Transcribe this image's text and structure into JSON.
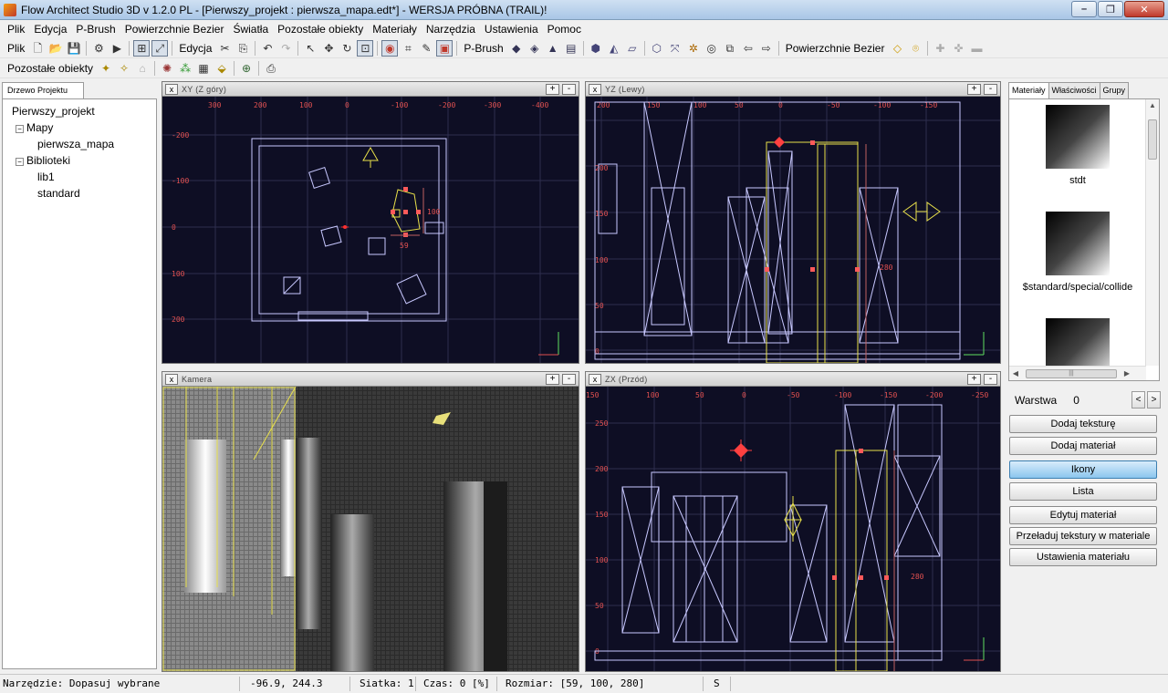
{
  "window": {
    "title": "Flow Architect Studio 3D v 1.2.0 PL  - [Pierwszy_projekt : pierwsza_mapa.edt*]  - WERSJA PRÓBNA (TRAIL)!"
  },
  "menu": [
    "Plik",
    "Edycja",
    "P-Brush",
    "Powierzchnie Bezier",
    "Światła",
    "Pozostałe obiekty",
    "Materiały",
    "Narzędzia",
    "Ustawienia",
    "Pomoc"
  ],
  "toolbar": {
    "plik": "Plik",
    "edycja": "Edycja",
    "pbrush": "P-Brush",
    "bezier": "Powierzchnie Bezier",
    "pozostale": "Pozostałe obiekty"
  },
  "left_panel": {
    "tab": "Drzewo Projektu",
    "tree": {
      "root": "Pierwszy_projekt",
      "mapy": "Mapy",
      "mapa": "pierwsza_mapa",
      "biblioteki": "Biblioteki",
      "lib1": "lib1",
      "standard": "standard"
    }
  },
  "viewports": {
    "xy": {
      "title": "XY (Z góry)",
      "close": "x",
      "plus": "+",
      "minus": "-",
      "xticks": [
        "300",
        "200",
        "100",
        "0",
        "-100",
        "-200",
        "-300",
        "-400"
      ],
      "yticks": [
        "-200",
        "-100",
        "0",
        "100",
        "200"
      ],
      "dim1": "100",
      "dim2": "59"
    },
    "yz": {
      "title": "YZ (Lewy)",
      "close": "x",
      "plus": "+",
      "minus": "-",
      "xticks": [
        "200",
        "150",
        "100",
        "50",
        "0",
        "-50",
        "-100",
        "-150"
      ],
      "yticks": [
        "200",
        "150",
        "100",
        "50",
        "0"
      ],
      "dim": "280"
    },
    "cam": {
      "title": "Kamera",
      "close": "x",
      "plus": "+",
      "minus": "-"
    },
    "zx": {
      "title": "ZX (Przód)",
      "close": "x",
      "plus": "+",
      "minus": "-",
      "xticks": [
        "150",
        "100",
        "50",
        "0",
        "-50",
        "-100",
        "-150",
        "-200",
        "-250"
      ],
      "yticks": [
        "250",
        "200",
        "150",
        "100",
        "50",
        "0"
      ],
      "dim": "280"
    }
  },
  "right_panel": {
    "tabs": [
      "Materiały",
      "Właściwości",
      "Grupy"
    ],
    "materials": [
      "stdt",
      "$standard/special/collide"
    ],
    "layer_label": "Warstwa",
    "layer_value": "0",
    "layer_prev": "<",
    "layer_next": ">",
    "buttons": {
      "add_texture": "Dodaj teksturę",
      "add_material": "Dodaj materiał",
      "icons": "Ikony",
      "list": "Lista",
      "edit_material": "Edytuj materiał",
      "reload": "Przeładuj tekstury w materiale",
      "settings": "Ustawienia materiału"
    }
  },
  "status": {
    "tool": "Narzędzie:  Dopasuj wybrane",
    "coords": "-96.9, 244.3",
    "grid": "Siatka: 1",
    "time": "Czas: 0 [%]",
    "size": "Rozmiar: [59, 100, 280]",
    "mode": "S"
  },
  "colors": {
    "viewport_bg": "#0e0e24",
    "wire": "#c8c8ff",
    "selected": "#e8e04a",
    "tick": "#e05050",
    "handle": "#ff5a5a"
  }
}
